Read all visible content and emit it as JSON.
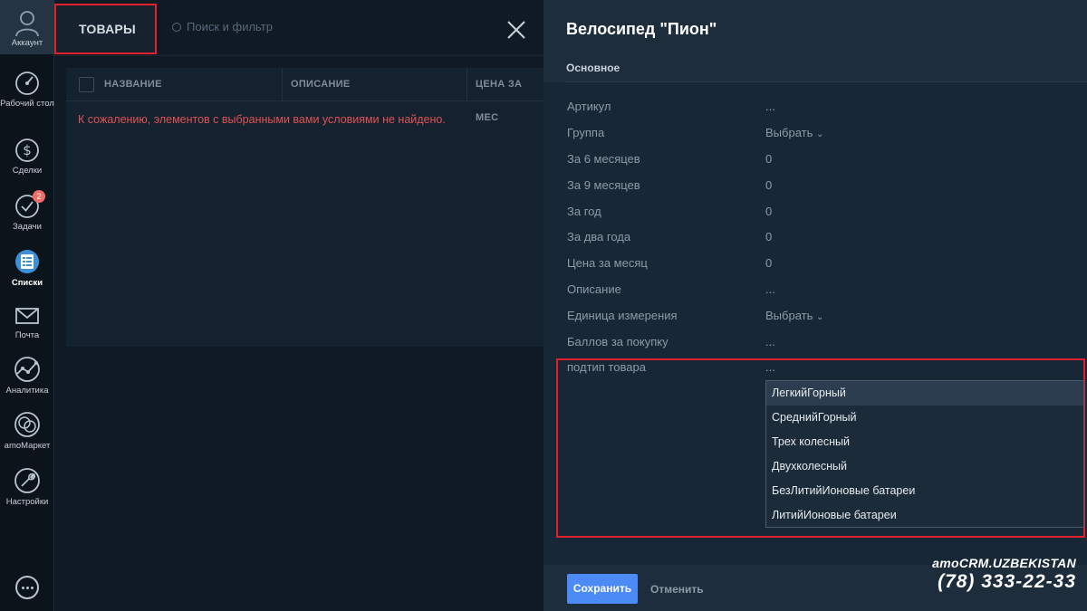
{
  "sidebar": {
    "account_label": "Аккаунт",
    "items": [
      {
        "label": "Рабочий стол",
        "icon": "dashboard-icon"
      },
      {
        "label": "Сделки",
        "icon": "dollar-icon"
      },
      {
        "label": "Задачи",
        "icon": "check-icon",
        "badge": "2"
      },
      {
        "label": "Списки",
        "icon": "lists-icon",
        "active": true
      },
      {
        "label": "Почта",
        "icon": "mail-icon"
      },
      {
        "label": "Аналитика",
        "icon": "analytics-icon"
      },
      {
        "label": "amoМаркет",
        "icon": "market-icon"
      },
      {
        "label": "Настройки",
        "icon": "settings-icon"
      }
    ]
  },
  "list": {
    "title": "ТОВАРЫ",
    "search_placeholder": "Поиск и фильтр",
    "columns": [
      "НАЗВАНИЕ",
      "ОПИСАНИЕ",
      "ЦЕНА ЗА МЕС"
    ],
    "empty_message": "К сожалению, элементов с выбранными вами условиями не найдено."
  },
  "panel": {
    "title": "Велосипед \"Пион\"",
    "tab": "Основное",
    "fields": [
      {
        "label": "Артикул",
        "value": "..."
      },
      {
        "label": "Группа",
        "value": "Выбрать"
      },
      {
        "label": "За 6 месяцев",
        "value": "0"
      },
      {
        "label": "За 9 месяцев",
        "value": "0"
      },
      {
        "label": "За год",
        "value": "0"
      },
      {
        "label": "За два года",
        "value": "0"
      },
      {
        "label": "Цена за месяц",
        "value": "0"
      },
      {
        "label": "Описание",
        "value": "..."
      },
      {
        "label": "Единица измерения",
        "value": "Выбрать"
      },
      {
        "label": "Баллов за покупку",
        "value": "..."
      },
      {
        "label": "подтип товара",
        "value": "..."
      }
    ],
    "dropdown_options": [
      "ЛегкийГорный",
      "СреднийГорный",
      "Трех колесный",
      "Двухколесный",
      "БезЛитийИоновые батареи",
      "ЛитийИоновые батареи"
    ],
    "save_label": "Сохранить",
    "cancel_label": "Отменить"
  },
  "watermark": {
    "brand": "amoCRM.UZBEKISTAN",
    "phone": "(78) 333-22-33"
  },
  "colors": {
    "accent": "#4c8bf5",
    "highlight": "#e0202a",
    "error": "#e05252",
    "badge": "#f26b6b"
  }
}
